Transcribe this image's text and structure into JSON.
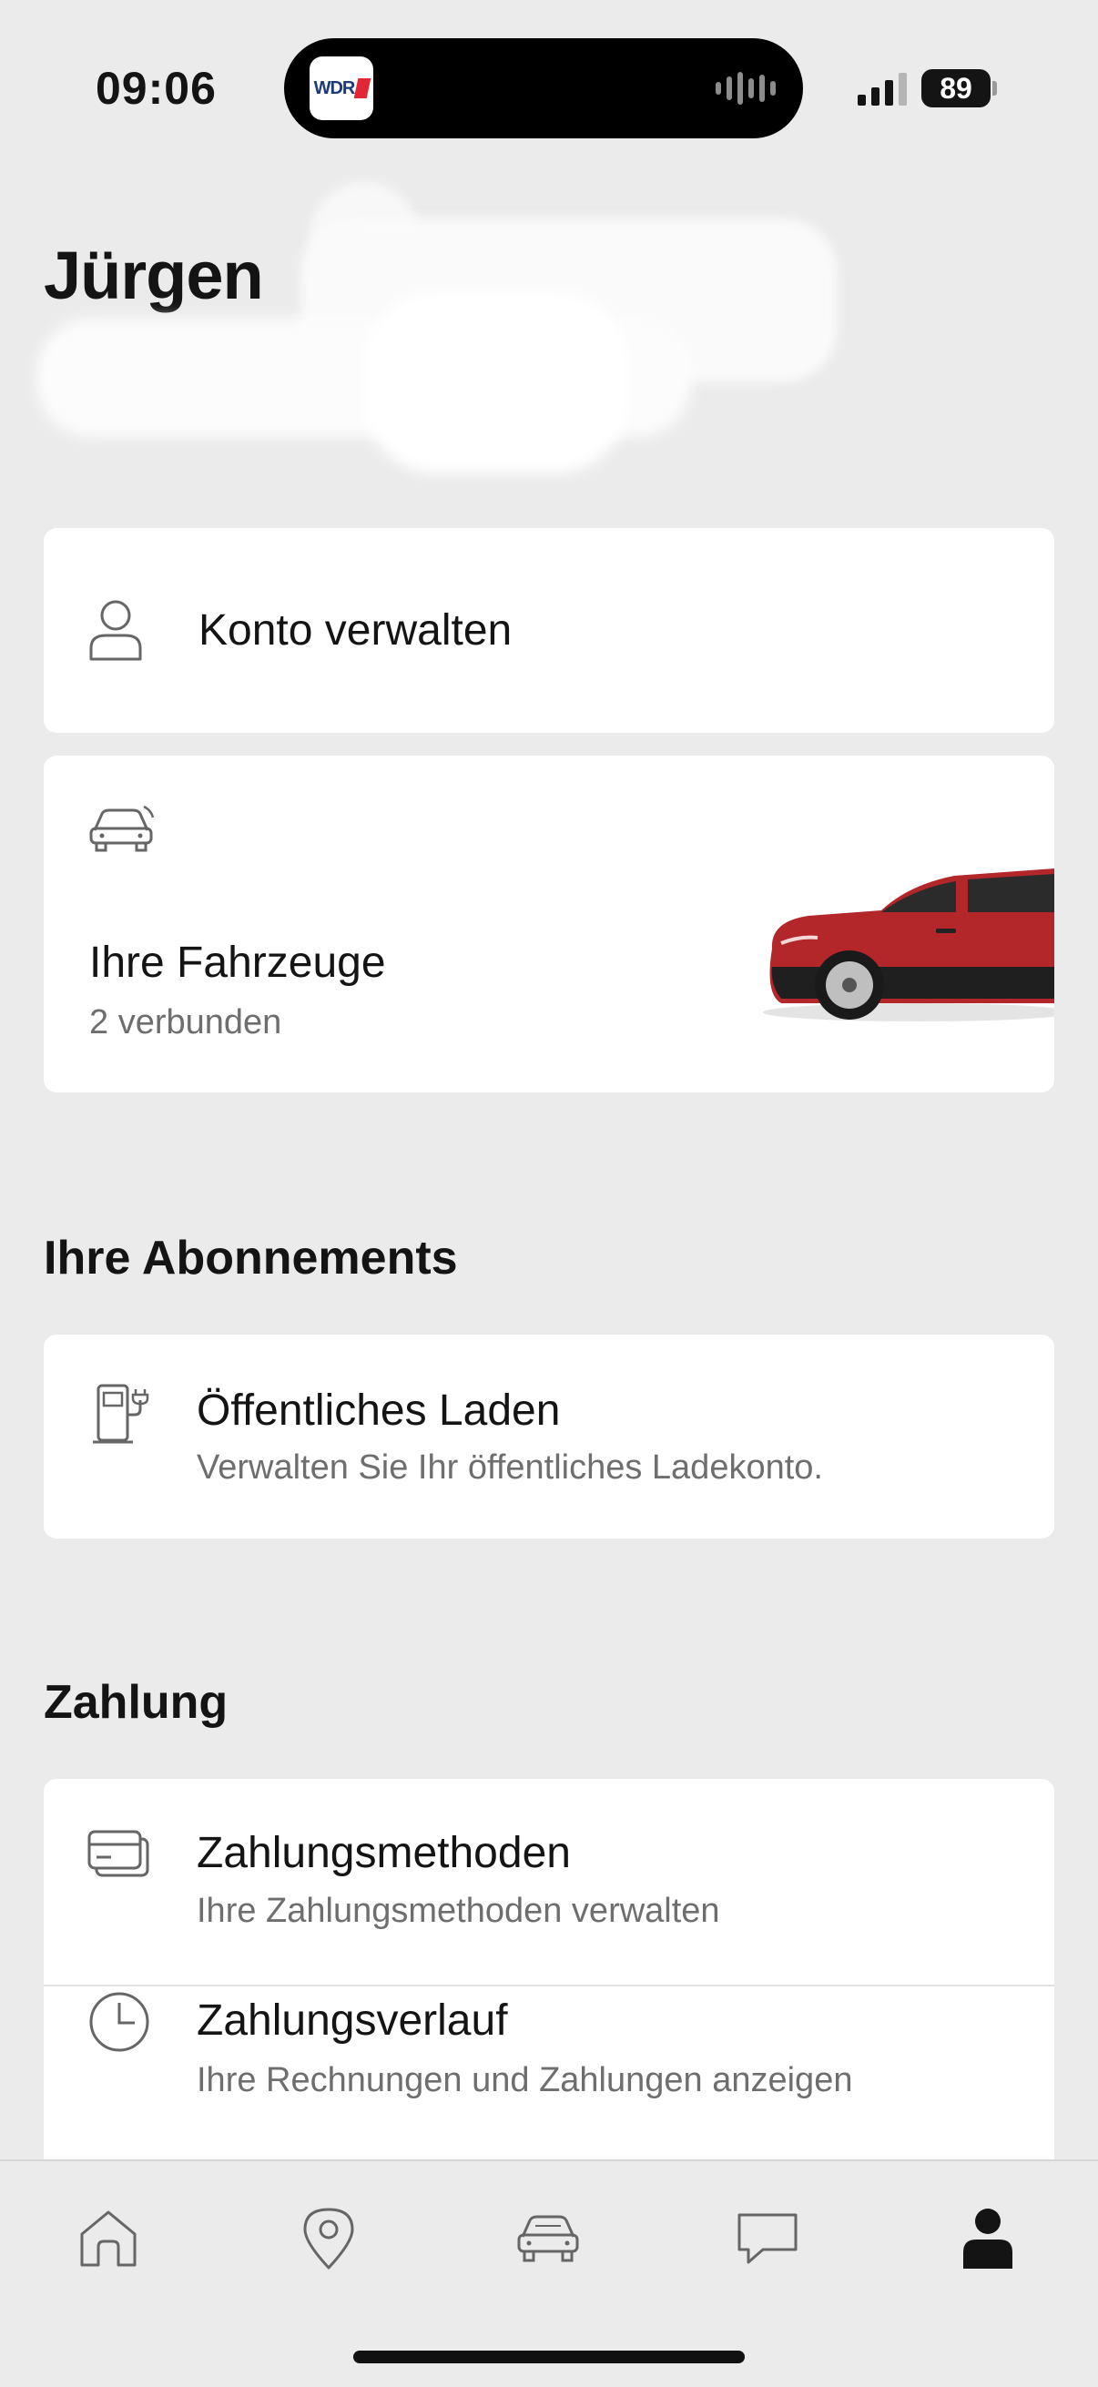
{
  "status_bar": {
    "time": "09:06",
    "island_app_label": "WDR",
    "battery": "89"
  },
  "header": {
    "title": "Jürgen"
  },
  "account": {
    "manage_label": "Konto verwalten"
  },
  "vehicles": {
    "title": "Ihre Fahrzeuge",
    "subtitle": "2 verbunden",
    "car_color": "#b3262a"
  },
  "subscriptions": {
    "section_title": "Ihre Abonnements",
    "items": [
      {
        "title": "Öffentliches Laden",
        "subtitle": "Verwalten Sie Ihr öffentliches Ladekonto.",
        "icon": "charging-station-icon"
      }
    ]
  },
  "payment": {
    "section_title": "Zahlung",
    "items": [
      {
        "title": "Zahlungsmethoden",
        "subtitle": "Ihre Zahlungsmethoden verwalten",
        "icon": "credit-card-icon"
      },
      {
        "title": "Zahlungsverlauf",
        "subtitle": "Ihre Rechnungen und Zahlungen anzeigen",
        "icon": "clock-icon"
      }
    ]
  },
  "tabbar": {
    "tabs": [
      {
        "icon": "home-icon"
      },
      {
        "icon": "map-pin-icon"
      },
      {
        "icon": "car-icon"
      },
      {
        "icon": "chat-icon"
      },
      {
        "icon": "profile-icon",
        "active": true
      }
    ]
  },
  "colors": {
    "background": "#ebebeb",
    "card": "#ffffff",
    "text": "#141414",
    "secondary_text": "#6e6e6e"
  }
}
